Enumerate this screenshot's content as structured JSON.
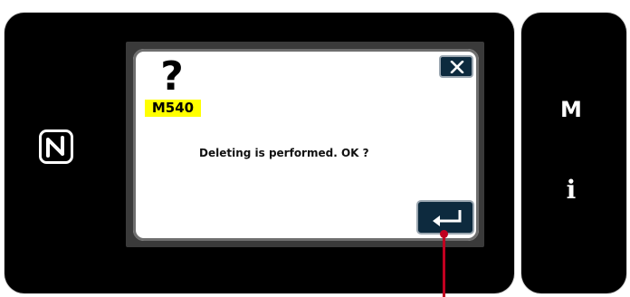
{
  "dialog": {
    "code": "M540",
    "message": "Deleting is performed. OK ?"
  },
  "side_panel": {
    "menu_key": "M",
    "info_key": "i"
  },
  "icons": {
    "nfc": "nfc-icon",
    "question": "question-mark-icon",
    "close": "close-icon",
    "enter": "enter-icon"
  },
  "colors": {
    "panel": "#000000",
    "badge": "#ffff00",
    "button": "#0d2a3e",
    "callout": "#c00020"
  }
}
